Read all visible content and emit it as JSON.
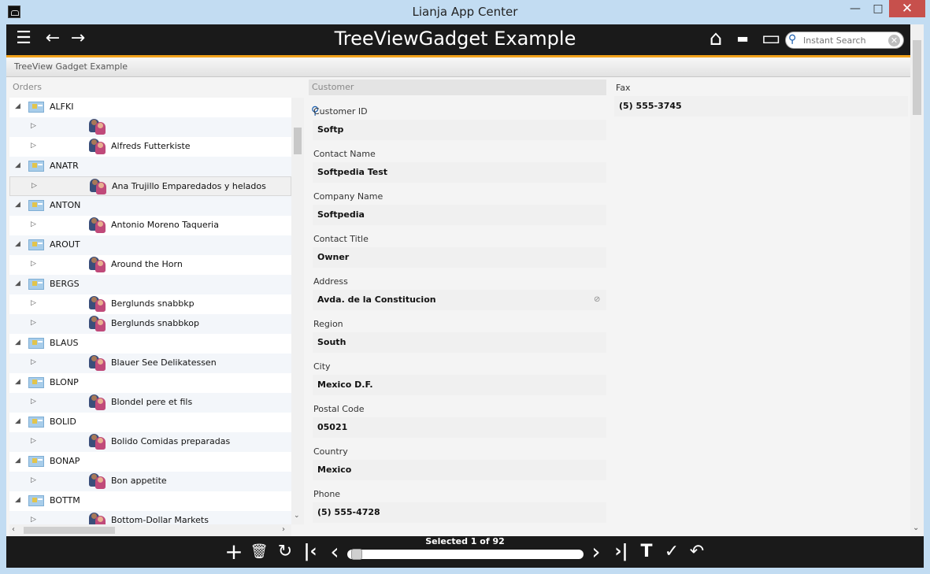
{
  "window": {
    "title": "Lianja App Center",
    "minimize": "—",
    "maximize": "□",
    "close": "✕"
  },
  "header": {
    "app_title": "TreeViewGadget Example",
    "menu_icon": "☰",
    "back_icon": "←",
    "forward_icon": "→",
    "home_icon": "⌂",
    "notes_icon": "▬",
    "display_icon": "▭",
    "search": {
      "placeholder": "Instant Search",
      "icon": "⚲",
      "clear": "✕"
    }
  },
  "section": {
    "title": "TreeView Gadget Example"
  },
  "tree": {
    "header": "Orders",
    "rows": [
      {
        "kind": "group",
        "label": "ALFKI"
      },
      {
        "kind": "child",
        "label": ""
      },
      {
        "kind": "child",
        "label": "Alfreds Futterkiste"
      },
      {
        "kind": "group",
        "label": "ANATR"
      },
      {
        "kind": "child",
        "label": "Ana Trujillo Emparedados y helados",
        "selected": true
      },
      {
        "kind": "group",
        "label": "ANTON"
      },
      {
        "kind": "child",
        "label": "Antonio Moreno Taqueria"
      },
      {
        "kind": "group",
        "label": "AROUT"
      },
      {
        "kind": "child",
        "label": "Around the Horn"
      },
      {
        "kind": "group",
        "label": "BERGS"
      },
      {
        "kind": "child",
        "label": "Berglunds snabbkp"
      },
      {
        "kind": "child",
        "label": "Berglunds snabbkop"
      },
      {
        "kind": "group",
        "label": "BLAUS"
      },
      {
        "kind": "child",
        "label": "Blauer See Delikatessen"
      },
      {
        "kind": "group",
        "label": "BLONP"
      },
      {
        "kind": "child",
        "label": "Blondel pere et fils"
      },
      {
        "kind": "group",
        "label": "BOLID"
      },
      {
        "kind": "child",
        "label": "Bolido Comidas preparadas"
      },
      {
        "kind": "group",
        "label": "BONAP"
      },
      {
        "kind": "child",
        "label": "Bon appetite"
      },
      {
        "kind": "group",
        "label": "BOTTM"
      },
      {
        "kind": "child",
        "label": "Bottom-Dollar Markets"
      }
    ]
  },
  "form": {
    "header": "Customer",
    "fields": [
      {
        "label": "Customer ID",
        "value": "Softp"
      },
      {
        "label": "Contact Name",
        "value": "Softpedia Test"
      },
      {
        "label": "Company Name",
        "value": "Softpedia"
      },
      {
        "label": "Contact Title",
        "value": "Owner"
      },
      {
        "label": "Address",
        "value": "Avda. de la Constitucion"
      },
      {
        "label": "Region",
        "value": "South"
      },
      {
        "label": "City",
        "value": "Mexico D.F."
      },
      {
        "label": "Postal Code",
        "value": "05021"
      },
      {
        "label": "Country",
        "value": "Mexico"
      },
      {
        "label": "Phone",
        "value": "(5) 555-4728"
      }
    ],
    "fax": {
      "label": "Fax",
      "value": "(5) 555-3745"
    }
  },
  "footer": {
    "status": "Selected 1 of 92",
    "position_fraction": 0.01,
    "add_icon": "+",
    "delete_icon": "🗑",
    "refresh_icon": "↻",
    "first_icon": "|‹",
    "prev_icon": "‹",
    "next_icon": "›",
    "last_icon": "›|",
    "filter_icon": "T",
    "save_icon": "✓",
    "undo_icon": "↶"
  }
}
